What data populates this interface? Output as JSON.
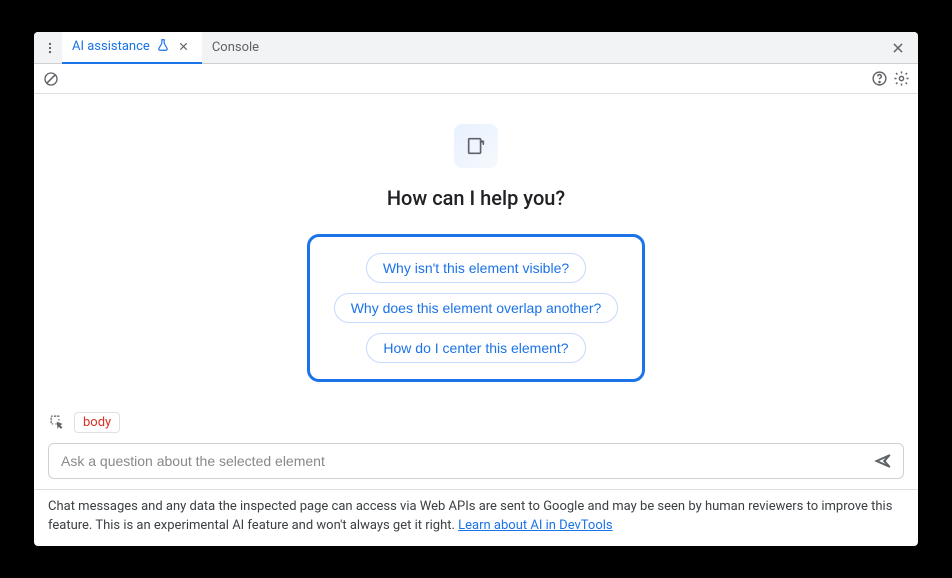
{
  "tabs": {
    "ai_assistance": "AI assistance",
    "console": "Console"
  },
  "heading": "How can I help you?",
  "suggestions": [
    "Why isn't this element visible?",
    "Why does this element overlap another?",
    "How do I center this element?"
  ],
  "context": {
    "selected_element": "body"
  },
  "input": {
    "placeholder": "Ask a question about the selected element"
  },
  "footer": {
    "text": "Chat messages and any data the inspected page can access via Web APIs are sent to Google and may be seen by human reviewers to improve this feature. This is an experimental AI feature and won't always get it right. ",
    "link_text": "Learn about AI in DevTools"
  }
}
